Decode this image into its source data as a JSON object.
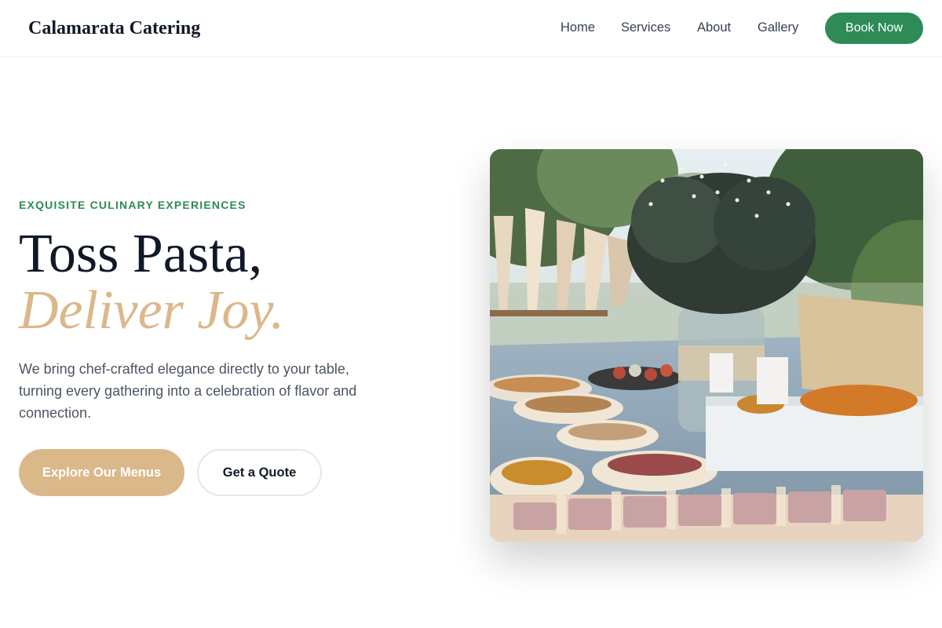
{
  "header": {
    "brand": "Calamarata Catering",
    "nav": [
      "Home",
      "Services",
      "About",
      "Gallery"
    ],
    "cta_label": "Book Now"
  },
  "hero": {
    "eyebrow": "EXQUISITE CULINARY EXPERIENCES",
    "headline_line1": "Toss Pasta,",
    "headline_line2": "Deliver Joy.",
    "lead": "We bring chef-crafted elegance directly to your table, turning every gathering into a celebration of flavor and connection.",
    "primary_cta": "Explore Our Menus",
    "secondary_cta": "Get a Quote",
    "image": {
      "subject": "outdoor catering buffet table with flowers and snacks"
    }
  },
  "colors": {
    "green": "#2e8b57",
    "tan": "#dbb88a",
    "dark": "#111827",
    "muted": "#4b5563"
  }
}
